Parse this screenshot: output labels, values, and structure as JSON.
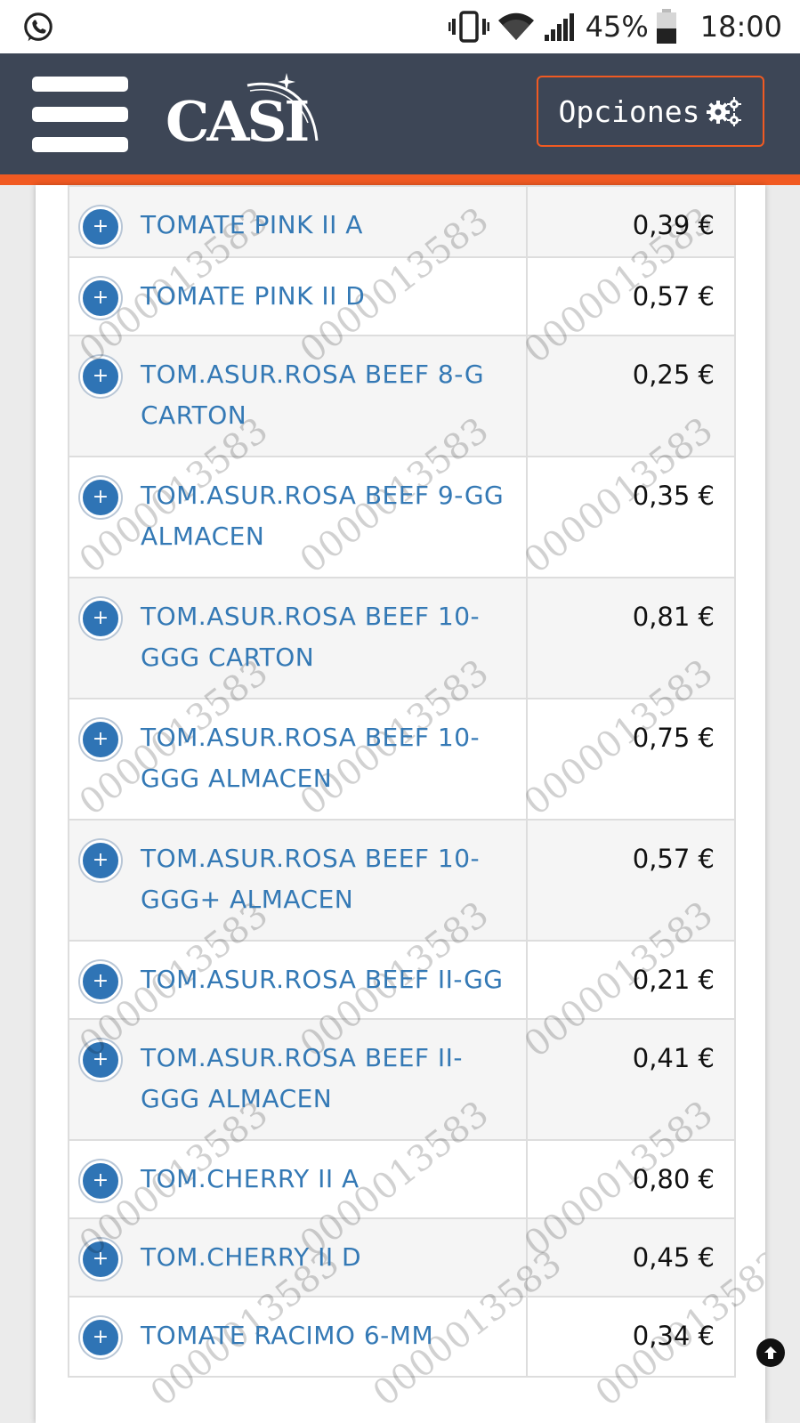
{
  "status_bar": {
    "battery_percent": "45%",
    "time": "18:00"
  },
  "header": {
    "logo_text": "CASI",
    "options_label": "Opciones"
  },
  "products": [
    {
      "name": "TOMATE PINK II A",
      "price": "0,39 €"
    },
    {
      "name": "TOMATE PINK II D",
      "price": "0,57 €"
    },
    {
      "name": "TOM.ASUR.ROSA BEEF 8-G CARTON",
      "price": "0,25 €"
    },
    {
      "name": "TOM.ASUR.ROSA BEEF 9-GG ALMACEN",
      "price": "0,35 €"
    },
    {
      "name": "TOM.ASUR.ROSA BEEF 10-GGG CARTON",
      "price": "0,81 €"
    },
    {
      "name": "TOM.ASUR.ROSA BEEF 10-GGG ALMACEN",
      "price": "0,75 €"
    },
    {
      "name": "TOM.ASUR.ROSA BEEF 10-GGG+ ALMACEN",
      "price": "0,57 €"
    },
    {
      "name": "TOM.ASUR.ROSA BEEF II-GG",
      "price": "0,21 €"
    },
    {
      "name": "TOM.ASUR.ROSA BEEF II-GGG ALMACEN",
      "price": "0,41 €"
    },
    {
      "name": "TOM.CHERRY II A",
      "price": "0,80 €"
    },
    {
      "name": "TOM.CHERRY II D",
      "price": "0,45 €"
    },
    {
      "name": "TOMATE RACIMO 6-MM",
      "price": "0,34 €"
    }
  ],
  "watermark_text": "0000013583",
  "icons": {
    "status": [
      "whatsapp-icon",
      "vibrate-icon",
      "wifi-icon",
      "signal-icon",
      "battery-icon"
    ],
    "header": [
      "menu-icon",
      "gears-icon"
    ],
    "rows": "plus-circle-icon",
    "floating": "arrow-up-circle-icon"
  },
  "colors": {
    "header_bg": "#3d4656",
    "accent": "#f15a22",
    "link": "#3479b5",
    "plus_bg": "#2f74b5"
  }
}
